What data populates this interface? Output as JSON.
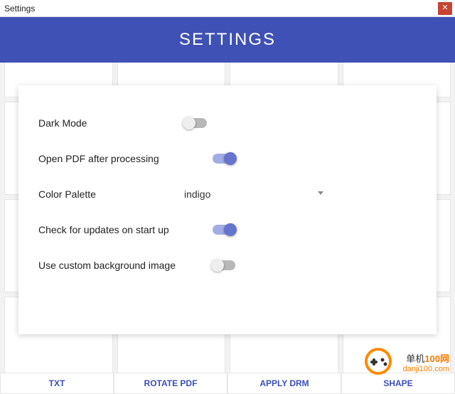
{
  "window": {
    "title": "Settings"
  },
  "banner": {
    "title": "SETTINGS"
  },
  "settings": {
    "dark_mode": {
      "label": "Dark Mode",
      "on": false
    },
    "open_pdf": {
      "label": "Open PDF after processing",
      "on": true
    },
    "palette": {
      "label": "Color Palette",
      "value": "indigo"
    },
    "check_updates": {
      "label": "Check for updates on start up",
      "on": true
    },
    "custom_bg": {
      "label": "Use custom background image",
      "on": false
    }
  },
  "background_buttons": [
    "TXT",
    "ROTATE PDF",
    "APPLY DRM",
    "SHAPE"
  ],
  "watermark": {
    "line1_a": "单机",
    "line1_b": "100网",
    "url": "danji100.com"
  },
  "colors": {
    "accent": "#3f51b5",
    "switch_on_track": "#a2aee3",
    "switch_on_knob": "#6574cd"
  }
}
